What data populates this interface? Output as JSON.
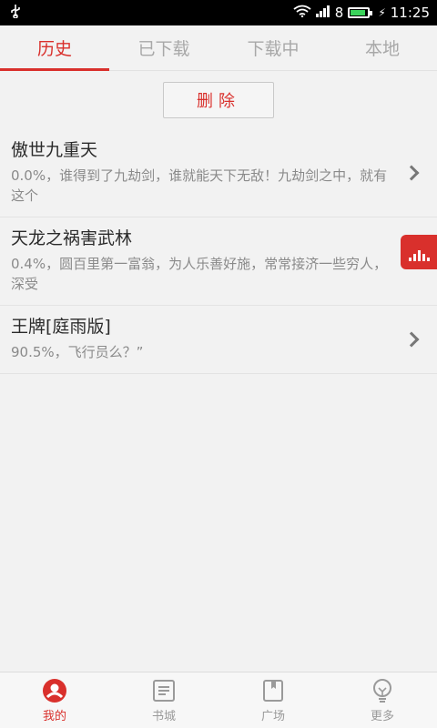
{
  "status_bar": {
    "signal_label": "8",
    "time": "11:25"
  },
  "tabs": [
    {
      "label": "历史",
      "active": true
    },
    {
      "label": "已下载",
      "active": false
    },
    {
      "label": "下载中",
      "active": false
    },
    {
      "label": "本地",
      "active": false
    }
  ],
  "delete_button": {
    "label": "删除"
  },
  "books": [
    {
      "title": "傲世九重天",
      "desc": "0.0%，谁得到了九劫剑，谁就能天下无敌！九劫剑之中，就有这个"
    },
    {
      "title": "天龙之祸害武林",
      "desc": "0.4%，圆百里第一富翁，为人乐善好施，常常接济一些穷人，深受"
    },
    {
      "title": "王牌[庭雨版]",
      "desc": "90.5%，飞行员么？”"
    }
  ],
  "bottom_nav": [
    {
      "label": "我的",
      "icon": "person-icon",
      "active": true
    },
    {
      "label": "书城",
      "icon": "document-icon",
      "active": false
    },
    {
      "label": "广场",
      "icon": "book-icon",
      "active": false
    },
    {
      "label": "更多",
      "icon": "bulb-icon",
      "active": false
    }
  ],
  "colors": {
    "accent": "#d9302c",
    "background": "#f2f2f2"
  }
}
